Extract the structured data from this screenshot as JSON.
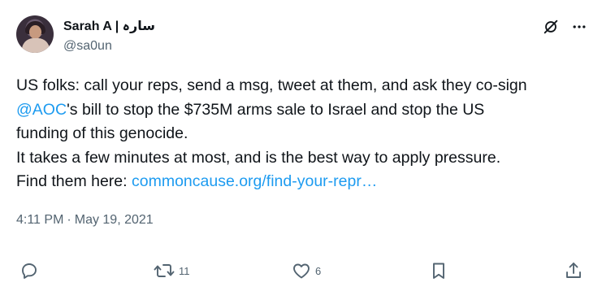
{
  "author": {
    "display_name": "Sarah A | سارہ",
    "handle": "@sa0un"
  },
  "header": {
    "icons": [
      "grok-icon",
      "more-icon"
    ]
  },
  "tweet": {
    "line1": "US folks: call your reps, send a msg, tweet at them, and ask they co-sign",
    "mention": "@AOC",
    "line2_rest": "'s bill to stop the $735M arms sale to Israel and stop the US",
    "line3": "funding of this genocide.",
    "line4": "It takes a few minutes at most, and is the best way to apply pressure.",
    "line5_prefix": "Find them here: ",
    "link": "commoncause.org/find-your-repr…"
  },
  "meta": {
    "time": "4:11 PM",
    "separator": "·",
    "date": "May 19, 2021"
  },
  "actions": {
    "reply_count": "",
    "retweet_count": "11",
    "like_count": "6"
  },
  "colors": {
    "link": "#1d9bf0",
    "text": "#0f1419",
    "muted": "#536471"
  }
}
